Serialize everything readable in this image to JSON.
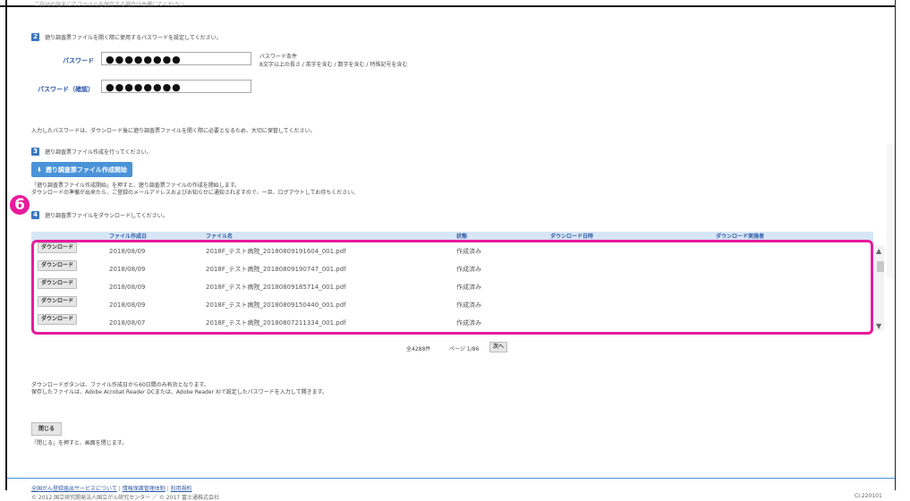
{
  "top_cut_text": "ご自分の端末にてファイルを保存する場合は本欄にてください",
  "step2": {
    "num": "2",
    "title": "遡り調査票ファイルを開く際に使用するパスワードを設定してください。",
    "password_label": "パスワード",
    "password_value": "●●●●●●●●",
    "password_confirm_label": "パスワード（確認）",
    "password_confirm_value": "●●●●●●●●",
    "cond_title": "パスワード条件",
    "cond_detail": "8文字以上の長さ / 英字を含む / 数字を含む / 特殊記号を含む"
  },
  "password_note": "入力したパスワードは、ダウンロード後に遡り調査票ファイルを開く際に必要となるため、大切に保管してください。",
  "step3": {
    "num": "3",
    "title": "遡り調査票ファイル作成を行ってください。",
    "button_label": "遡り調査票ファイル作成開始",
    "note1": "「遡り調査票ファイル作成開始」を押すと、遡り調査票ファイルの作成を開始します。",
    "note2": "ダウンロードの準備が出来たら、ご登録のメールアドレスおよびお知らせに通知されますので、一旦、ログアウトしてお待ちください。"
  },
  "marker": "6",
  "step4": {
    "num": "4",
    "title": "遡り調査票ファイルをダウンロードしてください。"
  },
  "table": {
    "headers": {
      "created": "ファイル作成日",
      "filename": "ファイル名",
      "status": "状態",
      "dl_date": "ダウンロード日時",
      "dl_user": "ダウンロード実施者"
    },
    "rows": [
      {
        "btn": "ダウンロード",
        "date": "2018/08/09",
        "file": "2018F_テスト病院_20180809191604_001.pdf",
        "status": "作成済み"
      },
      {
        "btn": "ダウンロード",
        "date": "2018/08/09",
        "file": "2018F_テスト病院_20180809190747_001.pdf",
        "status": "作成済み"
      },
      {
        "btn": "ダウンロード",
        "date": "2018/08/09",
        "file": "2018F_テスト病院_20180809185714_001.pdf",
        "status": "作成済み"
      },
      {
        "btn": "ダウンロード",
        "date": "2018/08/09",
        "file": "2018F_テスト病院_20180809150440_001.pdf",
        "status": "作成済み"
      },
      {
        "btn": "ダウンロード",
        "date": "2018/08/07",
        "file": "2018F_テスト病院_20180807211334_001.pdf",
        "status": "作成済み"
      }
    ],
    "pagination": {
      "total": "全4288件",
      "page": "ページ 1/86",
      "next": "次へ"
    }
  },
  "download_note1": "ダウンロードボタンは、ファイル作成日から60日間のみ有効となります。",
  "download_note2": "保存したファイルは、Adobe Acrobat Reader DCまたは、Adobe Reader XIで設定したパスワードを入力して開きます。",
  "close": {
    "button": "閉じる",
    "note": "「閉じる」を押すと、画面を閉じます。"
  },
  "footer": {
    "link1": "全国がん登録届出サービスについて",
    "link2": "情報保護管理体制",
    "link3": "利用規約",
    "copyright": "© 2012 国立研究開発法人国立がん研究センター ／ © 2017 富士通株式会社",
    "version": "CI.220101"
  }
}
